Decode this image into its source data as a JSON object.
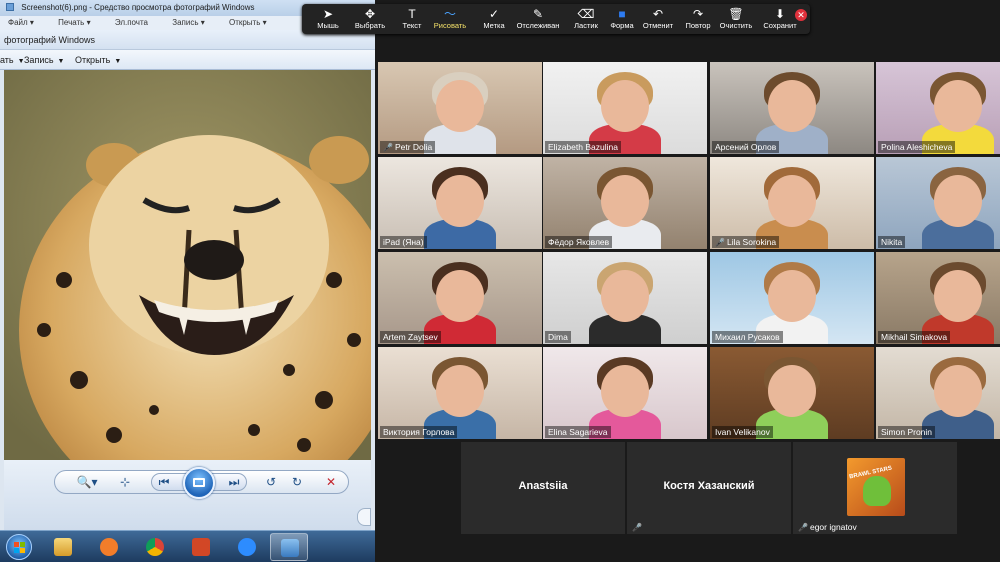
{
  "viewer": {
    "window_title": "Screenshot(6).png - Средство просмотра фотографий Windows",
    "menu_row": [
      "Файл ▾",
      "Печать ▾",
      "Эл.почта",
      "Запись ▾",
      "Открыть ▾"
    ],
    "title2": "фотографий Windows",
    "commands": [
      {
        "label": "ать",
        "arrow": "▼"
      },
      {
        "label": "Запись",
        "arrow": "▼"
      },
      {
        "label": "Открыть",
        "arrow": "▼"
      }
    ],
    "controls": {
      "zoom": "🔍▾",
      "fit": "⊹",
      "prev": "⏮",
      "next": "⏭",
      "rotate_left": "↺",
      "rotate_right": "↻",
      "delete": "✕"
    }
  },
  "annotation_toolbar": {
    "tools": [
      {
        "label": "Мышь",
        "icon": "cursor-icon",
        "glyph": "➤"
      },
      {
        "label": "Выбрать",
        "icon": "move-icon",
        "glyph": "✥"
      },
      {
        "label": "Текст",
        "icon": "text-icon",
        "glyph": "T"
      },
      {
        "label": "Рисовать",
        "icon": "draw-icon",
        "glyph": "〜",
        "selected": true
      },
      {
        "label": "Метка",
        "icon": "checkmark-icon",
        "glyph": "✓"
      },
      {
        "label": "Отслеживан",
        "icon": "spotlight-icon",
        "glyph": "✎"
      },
      {
        "label": "Ластик",
        "icon": "eraser-icon",
        "glyph": "⌫"
      },
      {
        "label": "Форма",
        "icon": "shape-icon",
        "glyph": "■"
      },
      {
        "label": "Отменит",
        "icon": "undo-icon",
        "glyph": "↶"
      },
      {
        "label": "Повтор",
        "icon": "redo-icon",
        "glyph": "↷"
      },
      {
        "label": "Очистить",
        "icon": "trash-icon",
        "glyph": "🗑"
      },
      {
        "label": "Сохранит",
        "icon": "save-icon",
        "glyph": "⬇"
      }
    ],
    "close_glyph": "✕"
  },
  "participants": [
    {
      "name": "Petr Dolia",
      "muted": true
    },
    {
      "name": "Elizabeth Bazulina",
      "muted": false,
      "speaking": true
    },
    {
      "name": "Арсений Орлов",
      "muted": false
    },
    {
      "name": "Polina  Aleshicheva",
      "muted": false
    },
    {
      "name": "iPad (Яна)",
      "muted": false
    },
    {
      "name": "Фёдор Яковлев",
      "muted": false
    },
    {
      "name": "Lila Sorokina",
      "muted": true
    },
    {
      "name": "Nikita",
      "muted": false
    },
    {
      "name": "Artem Zaytsev",
      "muted": false
    },
    {
      "name": "Dima",
      "muted": false
    },
    {
      "name": "Михаил Русаков",
      "muted": false
    },
    {
      "name": "Mikhail Simakova",
      "muted": false
    },
    {
      "name": "Виктория Горлова",
      "muted": false
    },
    {
      "name": "Elina Sagarieva",
      "muted": false
    },
    {
      "name": "Ivan Velikanov",
      "muted": false
    },
    {
      "name": "Simon Pronin",
      "muted": false
    }
  ],
  "audio_only": [
    {
      "name": "Anastsiia",
      "label": "",
      "muted": false
    },
    {
      "name": "Костя Хазанский",
      "label": "",
      "muted": true
    },
    {
      "name": "",
      "label": "egor ignatov",
      "muted": true,
      "avatar": "brawl-stars-avatar"
    }
  ],
  "avatar_text": "BRAWL STARS",
  "mic_glyph": "🎤"
}
